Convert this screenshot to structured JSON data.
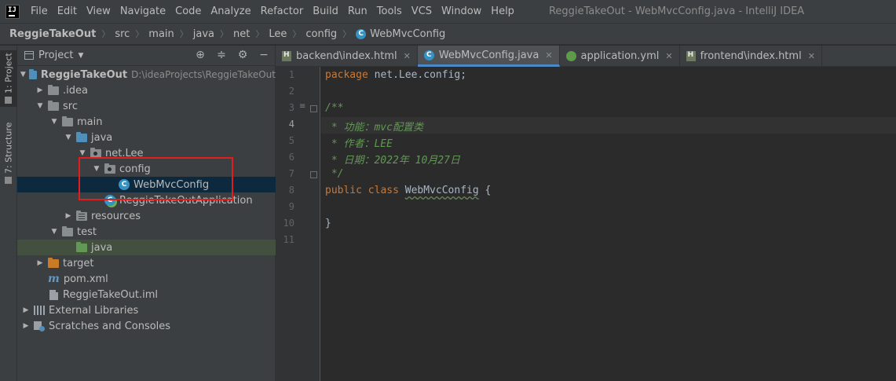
{
  "menubar": {
    "logo_text": "IJ",
    "items": [
      "File",
      "Edit",
      "View",
      "Navigate",
      "Code",
      "Analyze",
      "Refactor",
      "Build",
      "Run",
      "Tools",
      "VCS",
      "Window",
      "Help"
    ],
    "window_title": "ReggieTakeOut - WebMvcConfig.java - IntelliJ IDEA"
  },
  "breadcrumb": {
    "items": [
      "ReggieTakeOut",
      "src",
      "main",
      "java",
      "net",
      "Lee",
      "config",
      "WebMvcConfig"
    ]
  },
  "tool_stripe": {
    "project_tab": "1: Project",
    "structure_tab": "7: Structure"
  },
  "project_panel": {
    "title": "Project",
    "tree": [
      {
        "label": "ReggieTakeOut",
        "path": "D:\\ideaProjects\\ReggieTakeOut",
        "icon": "module-folder-icon",
        "expanded": true
      },
      {
        "label": ".idea",
        "icon": "folder-icon",
        "expanded": false
      },
      {
        "label": "src",
        "icon": "folder-icon",
        "expanded": true
      },
      {
        "label": "main",
        "icon": "folder-icon",
        "expanded": true
      },
      {
        "label": "java",
        "icon": "source-folder-icon",
        "expanded": true
      },
      {
        "label": "net.Lee",
        "icon": "package-icon",
        "expanded": true
      },
      {
        "label": "config",
        "icon": "package-icon",
        "expanded": true
      },
      {
        "label": "WebMvcConfig",
        "icon": "java-class-icon",
        "selected": true
      },
      {
        "label": "ReggieTakeOutApplication",
        "icon": "spring-boot-class-icon"
      },
      {
        "label": "resources",
        "icon": "resources-folder-icon",
        "expanded": false
      },
      {
        "label": "test",
        "icon": "folder-icon",
        "expanded": true
      },
      {
        "label": "java",
        "icon": "test-source-folder-icon"
      },
      {
        "label": "target",
        "icon": "excluded-folder-icon",
        "expanded": false
      },
      {
        "label": "pom.xml",
        "icon": "maven-icon"
      },
      {
        "label": "ReggieTakeOut.iml",
        "icon": "iml-file-icon"
      },
      {
        "label": "External Libraries",
        "icon": "libraries-icon",
        "expanded": false
      },
      {
        "label": "Scratches and Consoles",
        "icon": "scratches-icon",
        "expanded": false
      }
    ]
  },
  "tabs": [
    {
      "label": "backend\\index.html",
      "icon": "html-file-icon"
    },
    {
      "label": "WebMvcConfig.java",
      "icon": "java-class-icon",
      "active": true
    },
    {
      "label": "application.yml",
      "icon": "yaml-file-icon"
    },
    {
      "label": "frontend\\index.html",
      "icon": "html-file-icon"
    }
  ],
  "editor": {
    "current_line": 4,
    "lines": [
      {
        "n": "1",
        "parts": [
          [
            "kw",
            "package "
          ],
          [
            "",
            "net.Lee.config;"
          ]
        ]
      },
      {
        "n": "2",
        "parts": []
      },
      {
        "n": "3",
        "parts": [
          [
            "cm",
            "/**"
          ]
        ]
      },
      {
        "n": "4",
        "parts": [
          [
            "cm",
            " * 功能：mvc配置类"
          ]
        ]
      },
      {
        "n": "5",
        "parts": [
          [
            "cm",
            " * 作者：LEE"
          ]
        ]
      },
      {
        "n": "6",
        "parts": [
          [
            "cm",
            " * 日期：2022年 10月27日"
          ]
        ]
      },
      {
        "n": "7",
        "parts": [
          [
            "cm",
            " */"
          ]
        ]
      },
      {
        "n": "8",
        "parts": [
          [
            "kw",
            "public class "
          ],
          [
            "cls",
            "WebMvcConfig"
          ],
          [
            "",
            " {"
          ]
        ]
      },
      {
        "n": "9",
        "parts": []
      },
      {
        "n": "10",
        "parts": [
          [
            "",
            "}"
          ]
        ]
      },
      {
        "n": "11",
        "parts": []
      }
    ]
  },
  "colors": {
    "background": "#2b2b2b",
    "panel": "#3c3f41",
    "selection": "#0d293e",
    "keyword": "#cc7832",
    "comment": "#629755",
    "highlight_box": "#e01e1e"
  }
}
